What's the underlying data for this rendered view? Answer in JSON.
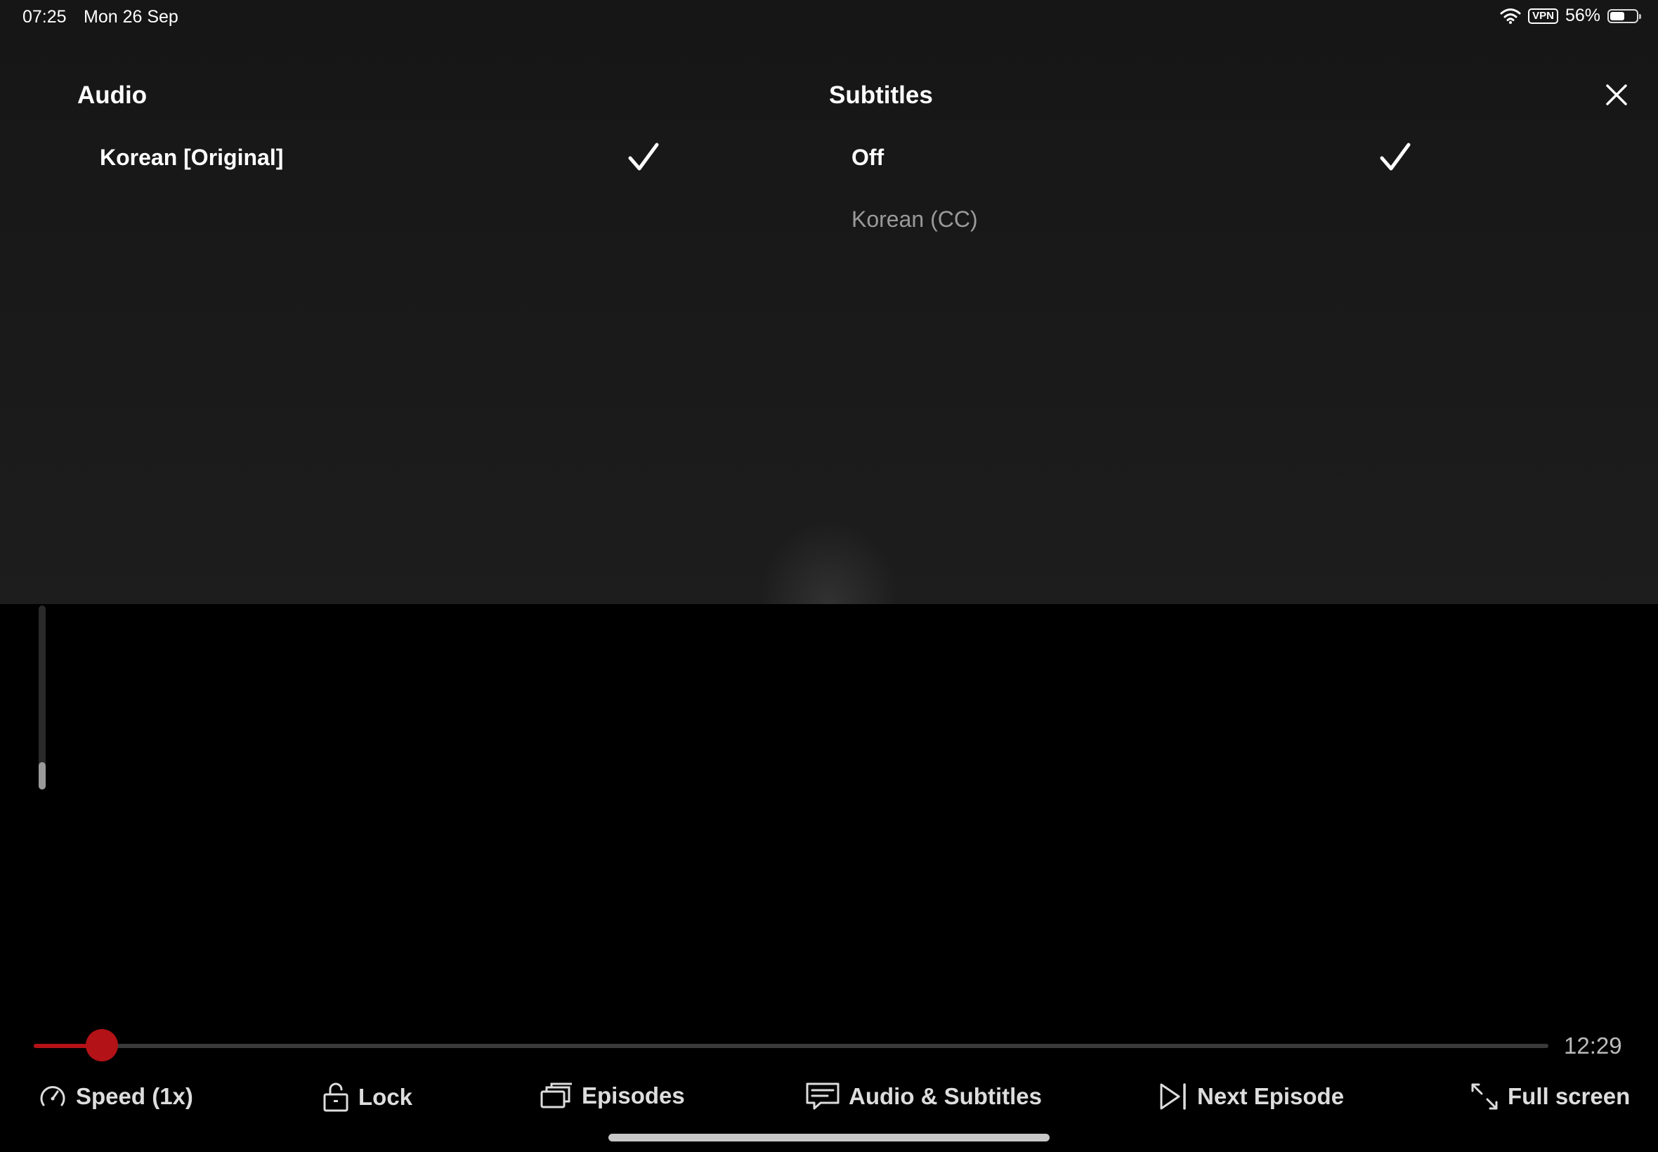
{
  "status_bar": {
    "time": "07:25",
    "date": "Mon 26 Sep",
    "vpn": "VPN",
    "battery_percent": "56%",
    "battery_level": 0.56
  },
  "audio": {
    "title": "Audio",
    "options": [
      {
        "label": "Korean [Original]",
        "selected": true
      }
    ]
  },
  "subtitles": {
    "title": "Subtitles",
    "options": [
      {
        "label": "Off",
        "selected": true
      },
      {
        "label": "Korean (CC)",
        "selected": false
      }
    ]
  },
  "volume": {
    "level": 0.15
  },
  "player": {
    "progress": 0.045,
    "time_remaining": "12:29",
    "accent_color": "#b31217"
  },
  "controls": {
    "speed": "Speed (1x)",
    "lock": "Lock",
    "episodes": "Episodes",
    "audio_subtitles": "Audio & Subtitles",
    "next_episode": "Next Episode",
    "full_screen": "Full screen"
  },
  "icons": {
    "wifi": "wifi-icon",
    "battery": "battery-icon",
    "close": "close-icon",
    "check": "check-icon",
    "speed": "speedometer-icon",
    "lock": "unlock-icon",
    "episodes": "episodes-icon",
    "audio_subtitles": "subtitles-icon",
    "next_episode": "next-episode-icon",
    "full_screen": "expand-icon"
  }
}
